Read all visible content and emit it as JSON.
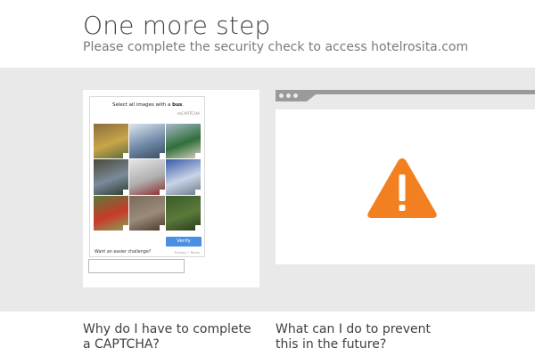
{
  "header": {
    "title": "One more step",
    "subtitle": "Please complete the security check to access hotelrosita.com"
  },
  "captcha": {
    "prompt_prefix": "Select all images with a ",
    "prompt_target": "bus",
    "prompt_suffix": ".",
    "brand_label": "reCAPTCHA",
    "tiles": [
      {
        "name": "captcha-tile-bus-yellow",
        "colors": [
          "#8a6d3b",
          "#c9a54a",
          "#5a6a3a"
        ]
      },
      {
        "name": "captcha-tile-bus-white",
        "colors": [
          "#dfe6ee",
          "#6f8aa8",
          "#3b4a5a"
        ]
      },
      {
        "name": "captcha-tile-street-sign",
        "colors": [
          "#a8b8c8",
          "#2f6f3a",
          "#d8d0c0"
        ]
      },
      {
        "name": "captcha-tile-road-sign",
        "colors": [
          "#4a4a3a",
          "#7a8a9a",
          "#2a3a2a"
        ]
      },
      {
        "name": "captcha-tile-bus-front",
        "colors": [
          "#e6e6e6",
          "#b0b0b0",
          "#8a2a2a"
        ]
      },
      {
        "name": "captcha-tile-bus-blue",
        "colors": [
          "#3a5aa8",
          "#c8d4e6",
          "#6a7a8a"
        ]
      },
      {
        "name": "captcha-tile-warning-sign",
        "colors": [
          "#5a7a3a",
          "#c83a2a",
          "#8aa05a"
        ]
      },
      {
        "name": "captcha-tile-car",
        "colors": [
          "#7a6a5a",
          "#9a8a7a",
          "#4a3a2a"
        ]
      },
      {
        "name": "captcha-tile-trees",
        "colors": [
          "#3a5a2a",
          "#5a7a3a",
          "#2a3a1a"
        ]
      }
    ],
    "verify_label": "Verify",
    "easier_label": "Want an easier challenge?",
    "privacy_label": "Privacy • Terms"
  },
  "colors": {
    "band": "#e9e9e9",
    "warning": "#f38020",
    "verify": "#4a90e2"
  },
  "faq": [
    {
      "question": "Why do I have to complete a CAPTCHA?"
    },
    {
      "question": "What can I do to prevent this in the future?"
    }
  ]
}
